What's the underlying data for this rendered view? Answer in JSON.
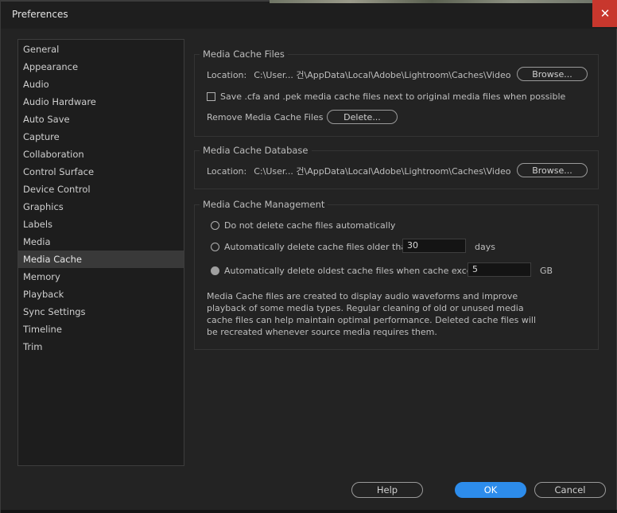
{
  "window": {
    "title": "Preferences",
    "close_glyph": "✕"
  },
  "sidebar": {
    "selected": "Media Cache",
    "items": [
      "General",
      "Appearance",
      "Audio",
      "Audio Hardware",
      "Auto Save",
      "Capture",
      "Collaboration",
      "Control Surface",
      "Device Control",
      "Graphics",
      "Labels",
      "Media",
      "Media Cache",
      "Memory",
      "Playback",
      "Sync Settings",
      "Timeline",
      "Trim"
    ]
  },
  "cache_files": {
    "legend": "Media Cache Files",
    "location_label": "Location:",
    "location_path": "C:\\User... 건\\AppData\\Local\\Adobe\\Lightroom\\Caches\\Video",
    "browse_label": "Browse...",
    "save_next_label": "Save .cfa and .pek media cache files next to original media files when possible",
    "save_next_checked": false,
    "remove_label": "Remove Media Cache Files",
    "delete_label": "Delete..."
  },
  "cache_database": {
    "legend": "Media Cache Database",
    "location_label": "Location:",
    "location_path": "C:\\User... 건\\AppData\\Local\\Adobe\\Lightroom\\Caches\\Video",
    "browse_label": "Browse..."
  },
  "cache_management": {
    "legend": "Media Cache Management",
    "option_none": "Do not delete cache files automatically",
    "option_age": "Automatically delete cache files older than:",
    "age_value": "30",
    "age_unit": "days",
    "option_size": "Automatically delete oldest cache files when cache exceeds:",
    "size_value": "5",
    "size_unit": "GB",
    "selected_option": "size",
    "description": "Media Cache files are created to display audio waveforms and improve playback of some media types.  Regular cleaning of old or unused media cache files can help maintain optimal performance. Deleted cache files will be recreated whenever source media requires them."
  },
  "footer": {
    "help_label": "Help",
    "ok_label": "OK",
    "cancel_label": "Cancel"
  },
  "colors": {
    "accent": "#2d8ceb",
    "close": "#c8372d"
  }
}
